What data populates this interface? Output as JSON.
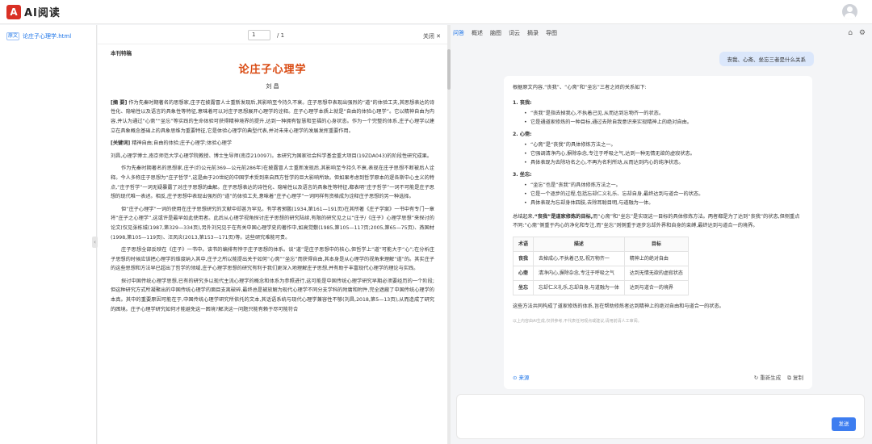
{
  "app": {
    "title": "AI阅读",
    "logo_mark": "A"
  },
  "sidebar": {
    "items": [
      {
        "tag": "原文",
        "label": "论庄子心理学.html"
      }
    ]
  },
  "doc_toolbar": {
    "page_value": "1",
    "page_total": "/ 1",
    "close_label": "关闭 ✕"
  },
  "document": {
    "kicker": "本刊特稿",
    "title": "论庄子心理学",
    "author": "刘 昌",
    "abstract_label": "[摘 要]",
    "abstract": "作为先秦时期著名的思想家,庄子在披露冒人士重新发现后,其影响至今持久不衰。庄子思想中表现出强烈的“道”的体验工夫,其思想表达的诗性化、隐喻性以及语言的具象性等特征,意味着可以对庄子思想展开心理学的诠释。庄子心理学本质上就是“自由的体验心理学”。它以精神自由为内容,并认为通过“心斋”“坐忘”等实践的生命体验可获得精神境界的提升,达到一种拥有智慧和至福的心身状态。作为一个完整的体系,庄子心理学以建立在具象概念基础上的具象思维为重要特征,它是体验心理学的典型代表,并对未来心理学的发展发挥重要作用。",
    "keywords_label": "[关键词]",
    "keywords": "精神自由;自由的体验;庄子心理学;体验心理学",
    "author_note": "刘昌,心理学博士,南京师范大学心理学院教授、博士生导师(南京210097)。本研究为国家社会科学基金重大项目(19ZDA043)的阶段性研究成果。",
    "paragraphs": [
      "作为先秦时期著名的思想家,庄子(约公元前369—公元前286年)在披露冒人士重新发现后,其影响至今持久不衰,表现在庄子思想不断被后人诠释。今人多称庄子思想为“庄子哲学”,这是由于20世纪的中国学术受到来自西方哲学的巨大影响所致。但如果考虑到哲学原本的逻各斯中心主义的特点,“庄子哲学”一词无疑暴露了对庄子思想的曲解。庄子思想表达的诗性化、隐喻性以及语言的具象性等特征,都表明“庄子哲学”一词不可能是庄子思想的现代唯一表述。相反,庄子思想中表现出强烈的“道”的体验工夫,意味着“庄子心理学”一词同样有资格成为诠释庄子思想的另一种选择。",
      "但“庄子心理学”一词的使用在庄子思想研究的文献中却甚为罕见。有学者郭鹏(1934,第161—191页)在其所著《庄子学案》一书中有专门一章将“庄子之心理学”,这或许是最早如此使用者。此后从心理学视角探讨庄子思想的研究陆续,有限的研究见之以“庄子/《庄子》心理学思想”来探讨的论文(仅见张栋城(1987,第329—334页),另外刘兄见于在有关中国心理学史的著作中,如高觉敷(1985,第105—117页;2005,第65—75页)、燕国材(1998,第105—119页)、汪凤炎(2013,第153—171页)等。这些研究难能可贵。",
      "庄子思想全部反映在《庄子》一书中。该书的编排有悖于庄子思想的体系。谈“道”是庄子思想中的核心,但哲学上“道”可能大于“心”;在分析庄子思想的时候应该把心理学的维度纳入其中,庄子之所以能提出关于如何“心斋”“坐忘”而获得自由,其本身是从心理学的视角来理解“道”的。其实庄子的这些思想和方法早已超出了哲学的领域,庄子心理学思想的研究有利于我们更深入地理解庄子思想,并有助于丰富现代心理学的理论与实践。",
      "探讨中国传统心理学思想,已有的研究多以现代主流心理学的概念和体系为参照进行,这可能是中国传统心理学研究早期必须要经历的一个阶段;但这种研究方式所凝聚出的中国传统心理学的面目支离破碎,最终总是被放解为现代心理学不同分支学科的附庸和附件,完全遮蔽了中国传统心理学的本真。其中的重要原因可能在于,中国传统心理学研究所依托的文本,其话语系统与现代心理学兼容性不够(刘昌,2018,第5—13页),从而造成了研究的困境。庄子心理学研究如何才能避免这一困境?解决这一问题只能有赖于尽可能符合"
    ]
  },
  "chat": {
    "tabs": [
      "问答",
      "概述",
      "脑图",
      "词云",
      "摘录",
      "导图"
    ],
    "active_tab": 0,
    "tab_icons": [
      "history-icon",
      "settings-icon"
    ],
    "user_question": "丧我、心斋、坐忘三者是什么关系",
    "answer": {
      "intro": "根据原文内容,“丧我”、“心斋”和“坐忘”三者之间的关系如下:",
      "sections": [
        {
          "head": "1. 丧我:",
          "bullets": [
            "“丧我”是指去掉我心,不执着己见,从而达到忘物齐一的状态。",
            "它是通道家修炼的一种目标,通过去除自我意识来实现精神上的绝对自由。"
          ]
        },
        {
          "head": "2. 心斋:",
          "bullets": [
            "“心斋”是“丧我”的具体修炼方法之一。",
            "它强调清净内心,摒除杂念,专注于呼吸之气,达到一种无情无欲的虚寂状态。",
            "具体表现为去除功名之心,不再为名利所动,从而达到内心的纯净状态。"
          ]
        },
        {
          "head": "3. 坐忘:",
          "bullets": [
            "“坐忘”也是“丧我”的具体修炼方法之一。",
            "它是一个逐步的过程,包括忘却仁义礼乐、忘却自身,最终达到与道合一的状态。",
            "具体表现为忘却身体四肢,去除耳聪目明,与道融为一体。"
          ]
        }
      ],
      "summary_prefix": "总结起来,",
      "summary_bold": "“丧我”是道家修炼的目标,",
      "summary_rest": "而“心斋”和“坐忘”是实现这一目标的具体修炼方法。两者都是为了达到“丧我”的状态,但侧重点不同:“心斋”侧重于内心的净化和专注,而“坐忘”则侧重于逐步忘却外界和自身的束缚,最终达到与道合一的境界。",
      "table": {
        "headers": [
          "术语",
          "描述",
          "目标"
        ],
        "rows": [
          [
            "丧我",
            "去掉成心,不执着己见,视万物齐一",
            "精神上的绝对自由"
          ],
          [
            "心斋",
            "清净内心,摒除杂念,专注于呼吸之气",
            "达到无情无欲的虚寂状态"
          ],
          [
            "坐忘",
            "忘却仁义礼乐,忘却自身,与道融为一体",
            "达到与道合一的境界"
          ]
        ]
      },
      "outro": "这些方法共同构成了道家修炼的体系,旨在帮助修炼者达到精神上的绝对自由和与道合一的状态。",
      "disclaimer": "以上内容由AI生成,仅供参考,不代表任何观点或建议,请用前请人工审阅。",
      "source_label": "来源",
      "actions": [
        "重新生成",
        "复制"
      ]
    },
    "input_placeholder": "",
    "send_label": "发送"
  }
}
